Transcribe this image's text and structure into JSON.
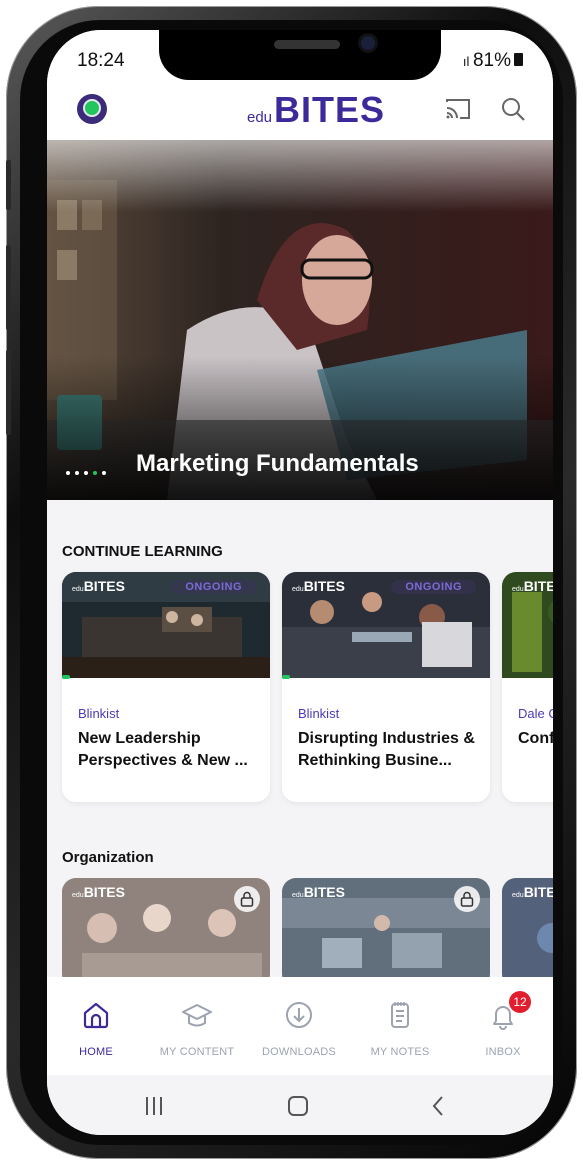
{
  "status_bar": {
    "time": "18:24",
    "battery": "81%"
  },
  "app": {
    "logo_prefix": "edu",
    "logo_main": "BITES"
  },
  "hero": {
    "title": "Marketing Fundamentals",
    "slide_count": 5,
    "active_slide": 4
  },
  "continue_learning": {
    "heading": "CONTINUE LEARNING",
    "cards": [
      {
        "author": "Blinkist",
        "title": "New Leadership Perspectives & New ...",
        "status": "ONGOING"
      },
      {
        "author": "Blinkist",
        "title": "Disrupting Industries & Rethinking Busine...",
        "status": "ONGOING"
      },
      {
        "author": "Dale C",
        "title": "Conf"
      }
    ]
  },
  "organization": {
    "heading": "Organization"
  },
  "bottom_nav": {
    "items": [
      {
        "label": "HOME",
        "icon": "home-icon"
      },
      {
        "label": "MY CONTENT",
        "icon": "graduation-cap-icon"
      },
      {
        "label": "DOWNLOADS",
        "icon": "download-icon"
      },
      {
        "label": "MY NOTES",
        "icon": "notes-icon"
      },
      {
        "label": "INBOX",
        "icon": "bell-icon"
      }
    ],
    "inbox_badge": "12"
  },
  "colors": {
    "brand": "#3b2b9a",
    "accent": "#22c55e",
    "badge": "#e11d2e"
  }
}
